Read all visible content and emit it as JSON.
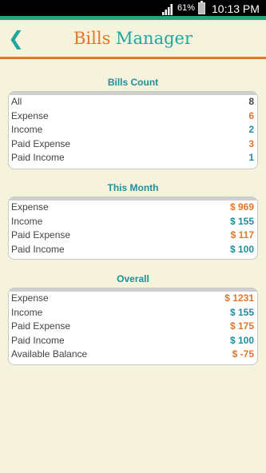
{
  "status_bar": {
    "battery": "61%",
    "time": "10:13 PM"
  },
  "header": {
    "title_part1": "Bills",
    "title_part2": "Manager",
    "back_icon": "chevron-left-icon"
  },
  "colors": {
    "orange": "#e2762a",
    "teal": "#1d8f9e",
    "dark": "#444444"
  },
  "sections": {
    "bills_count": {
      "title": "Bills Count",
      "rows": [
        {
          "label": "All",
          "value": "8",
          "color": "#444444"
        },
        {
          "label": "Expense",
          "value": "6",
          "color": "#e2762a"
        },
        {
          "label": "Income",
          "value": "2",
          "color": "#1d8f9e"
        },
        {
          "label": "Paid Expense",
          "value": "3",
          "color": "#e2762a"
        },
        {
          "label": "Paid Income",
          "value": "1",
          "color": "#1d8f9e"
        }
      ]
    },
    "this_month": {
      "title": "This Month",
      "rows": [
        {
          "label": "Expense",
          "value": "$ 969",
          "color": "#e2762a"
        },
        {
          "label": "Income",
          "value": "$ 155",
          "color": "#1d8f9e"
        },
        {
          "label": "Paid Expense",
          "value": "$ 117",
          "color": "#e2762a"
        },
        {
          "label": "Paid Income",
          "value": "$ 100",
          "color": "#1d8f9e"
        }
      ]
    },
    "overall": {
      "title": "Overall",
      "rows": [
        {
          "label": "Expense",
          "value": "$ 1231",
          "color": "#e2762a"
        },
        {
          "label": "Income",
          "value": "$ 155",
          "color": "#1d8f9e"
        },
        {
          "label": "Paid Expense",
          "value": "$ 175",
          "color": "#e2762a"
        },
        {
          "label": "Paid Income",
          "value": "$ 100",
          "color": "#1d8f9e"
        },
        {
          "label": "Available Balance",
          "value": "$ -75",
          "color": "#e2762a"
        }
      ]
    }
  }
}
